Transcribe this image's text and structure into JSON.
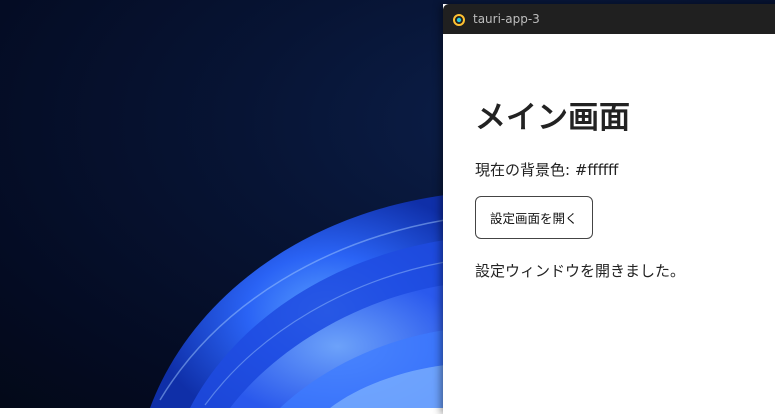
{
  "window": {
    "title": "tauri-app-3"
  },
  "main": {
    "heading": "メイン画面",
    "background_label": "現在の背景色: #ffffff",
    "open_settings_button": "設定画面を開く",
    "status_message": "設定ウィンドウを開きました。"
  },
  "colors": {
    "window_bg": "#ffffff",
    "titlebar_bg": "#202020",
    "desktop_bg": "#040b22",
    "wallpaper_accent": "#2563ff"
  },
  "icons": {
    "app_icon": "tauri-icon"
  }
}
